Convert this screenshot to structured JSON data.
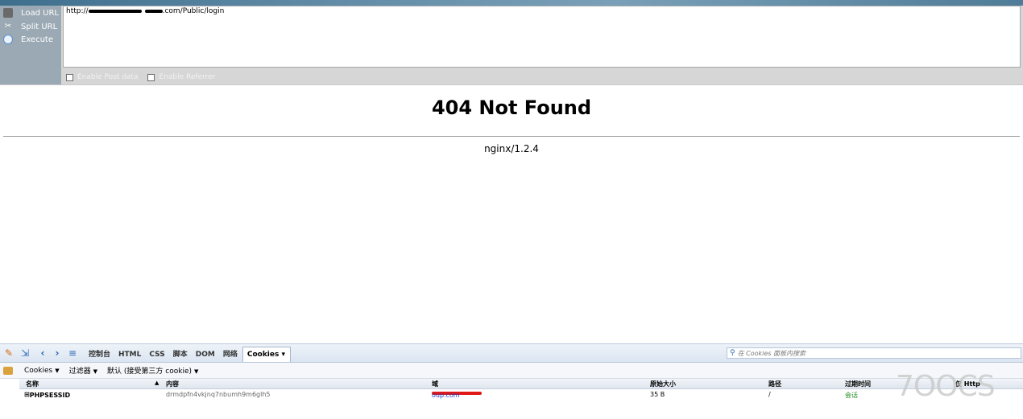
{
  "hackbar": {
    "menu": {
      "load_url": "Load URL",
      "split_url": "Split URL",
      "execute": "Execute"
    },
    "url_prefix": "http://",
    "url_suffix": ".com/Public/login",
    "options": {
      "post_data": "Enable Post data",
      "referrer": "Enable Referrer"
    }
  },
  "page": {
    "title": "404 Not Found",
    "server": "nginx/1.2.4"
  },
  "firebug": {
    "tabs": [
      "控制台",
      "HTML",
      "CSS",
      "脚本",
      "DOM",
      "网络",
      "Cookies ▾"
    ],
    "search_placeholder": "在 Cookies 面板内搜索",
    "subbar": {
      "cookies": "Cookies",
      "filter": "过滤器",
      "default": "默认 (接受第三方 cookie)"
    },
    "columns": {
      "name": "名称",
      "content": "内容",
      "domain": "域",
      "size": "原始大小",
      "path": "路径",
      "expires": "过期时间",
      "http_only": "仅 Http"
    },
    "rows": [
      {
        "name": "PHPSESSID",
        "content": "drmdpfn4vkjnq7nbumh9m6glh5",
        "domain_suffix": "oup.com",
        "size": "35 B",
        "path": "/",
        "expires": "会话"
      }
    ]
  },
  "watermark": "7OOCS"
}
